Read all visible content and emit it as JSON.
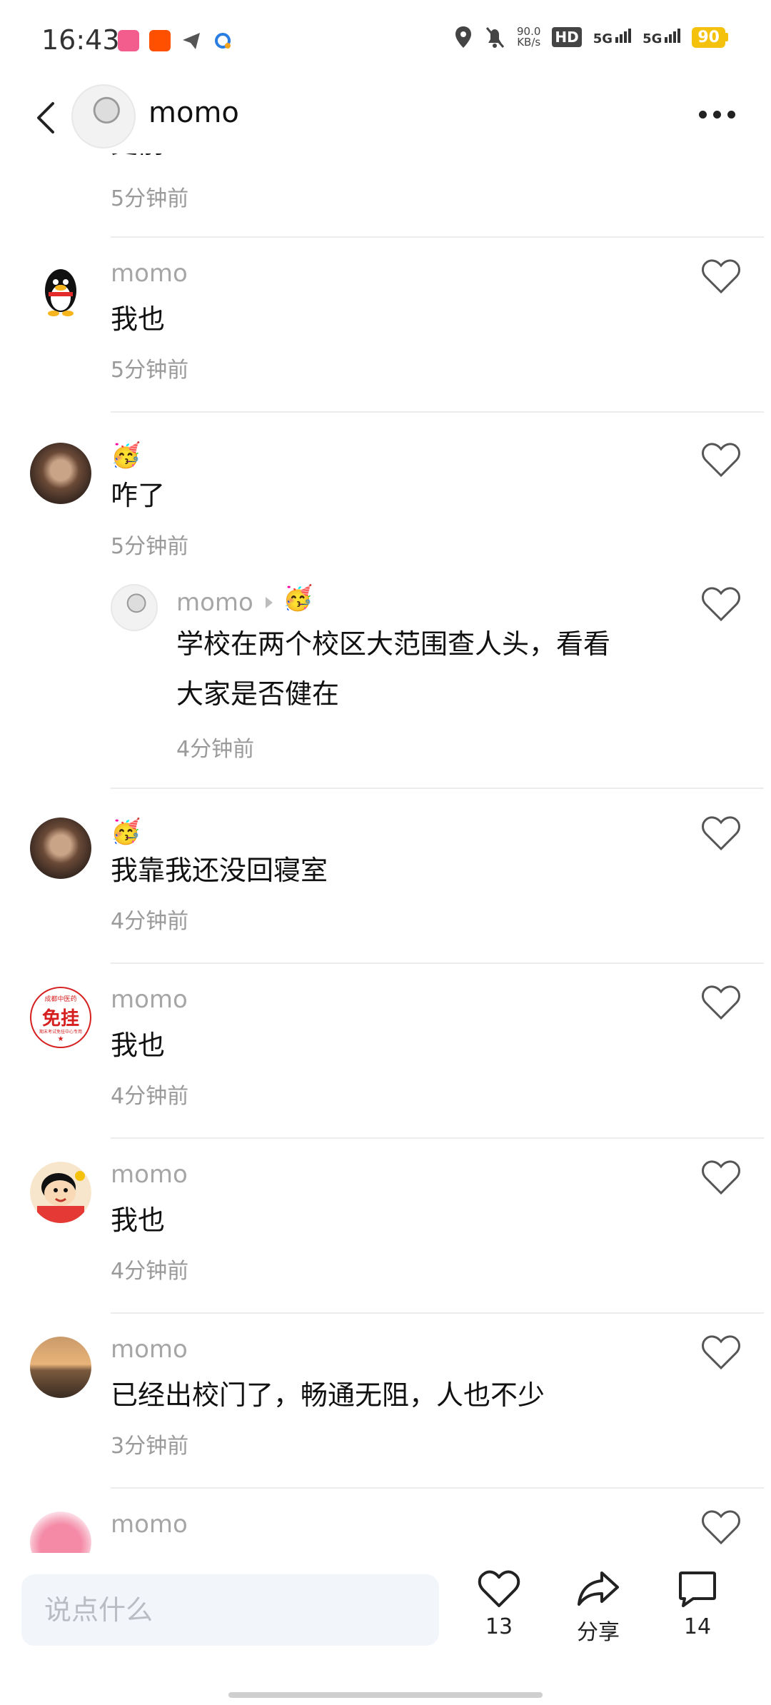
{
  "status_bar": {
    "time": "16:43",
    "net_speed_value": "90.0",
    "net_speed_unit": "KB/s",
    "hd_label": "HD",
    "sim1_label": "5G",
    "sim2_label": "5G",
    "battery": "90"
  },
  "header": {
    "title": "momo",
    "back_icon": "chevron-left-icon",
    "more_icon": "more-dots-icon"
  },
  "comments": [
    {
      "text": "史前",
      "time": "5分钟前"
    },
    {
      "name": "momo",
      "text": "我也",
      "time": "5分钟前",
      "avatar_icon": "penguin-avatar"
    },
    {
      "name_emoji": "🥳",
      "text": "咋了",
      "time": "5分钟前",
      "avatar_icon": "photo-avatar",
      "reply": {
        "name": "momo",
        "reply_emoji": "🥳",
        "text_line1": "学校在两个校区大范围查人头，看看",
        "text_line2": "大家是否健在",
        "time": "4分钟前"
      }
    },
    {
      "name_emoji": "🥳",
      "text": "我靠我还没回寝室",
      "time": "4分钟前",
      "avatar_icon": "photo-avatar"
    },
    {
      "name": "momo",
      "text": "我也",
      "time": "4分钟前",
      "avatar_icon": "stamp-avatar",
      "stamp_top": "成都中医药",
      "stamp_main": "免挂",
      "stamp_bottom": "期末考试免挂中心专用"
    },
    {
      "name": "momo",
      "text": "我也",
      "time": "4分钟前",
      "avatar_icon": "cartoon-avatar"
    },
    {
      "name": "momo",
      "text": "已经出校门了，畅通无阻，人也不少",
      "time": "3分钟前",
      "avatar_icon": "sunset-avatar"
    },
    {
      "name": "momo",
      "avatar_icon": "pink-creature-avatar"
    }
  ],
  "bottom_bar": {
    "input_placeholder": "说点什么",
    "like_count": "13",
    "share_label": "分享",
    "comment_count": "14"
  },
  "colors": {
    "battery": "#f4c20d",
    "input_bg": "#f2f5fa",
    "muted_text": "#a6a6a6"
  }
}
